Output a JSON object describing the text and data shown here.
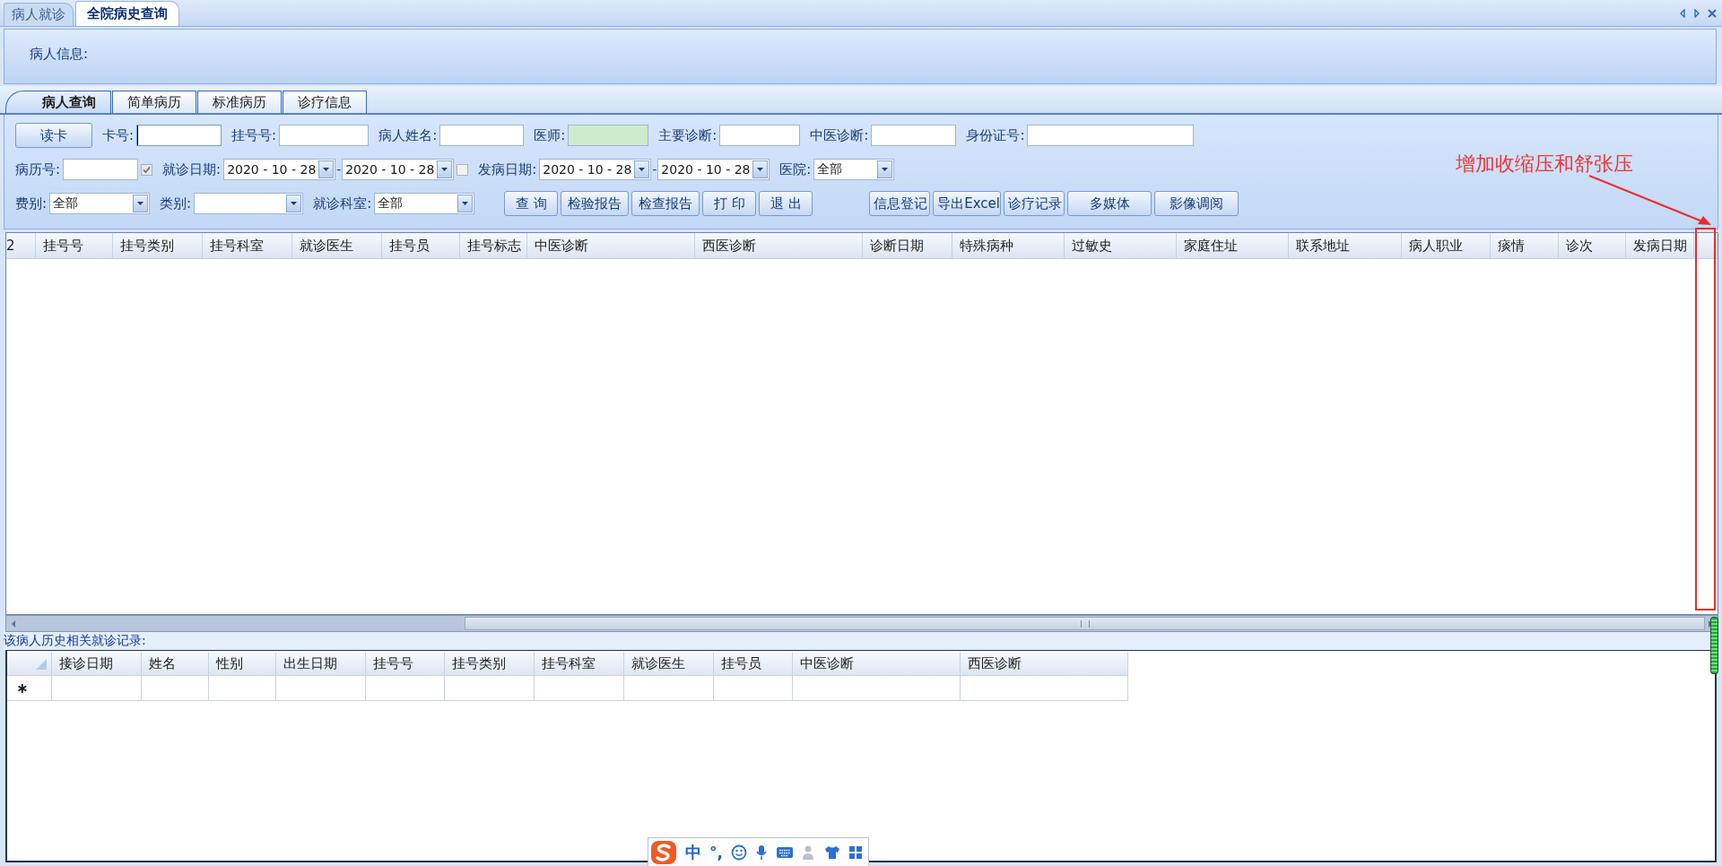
{
  "doc_tabs": [
    {
      "label": "病人就诊",
      "selected": false
    },
    {
      "label": "全院病史查询",
      "selected": true
    }
  ],
  "patient_info": {
    "label": "病人信息:"
  },
  "query_tabs": [
    {
      "label": "病人查询",
      "selected": true
    },
    {
      "label": "简单病历",
      "selected": false
    },
    {
      "label": "标准病历",
      "selected": false
    },
    {
      "label": "诊疗信息",
      "selected": false
    }
  ],
  "form": {
    "rows": [
      {
        "items": [
          {
            "kind": "button",
            "label": "读卡"
          },
          {
            "kind": "label",
            "text": "卡号:"
          },
          {
            "kind": "input",
            "focused": true
          },
          {
            "kind": "label",
            "text": "挂号号:"
          },
          {
            "kind": "input"
          },
          {
            "kind": "label",
            "text": "病人姓名:"
          },
          {
            "kind": "input"
          },
          {
            "kind": "label",
            "text": "医师:"
          },
          {
            "kind": "input",
            "readonly": true
          },
          {
            "kind": "label",
            "text": "主要诊断:"
          },
          {
            "kind": "input"
          },
          {
            "kind": "label",
            "text": "中医诊断:"
          },
          {
            "kind": "input"
          },
          {
            "kind": "label",
            "text": "身份证号:"
          },
          {
            "kind": "input"
          }
        ]
      },
      {
        "items": [
          {
            "kind": "label",
            "text": "病历号:"
          },
          {
            "kind": "input"
          },
          {
            "kind": "checkbox",
            "checked": true
          },
          {
            "kind": "label",
            "text": "就诊日期:"
          },
          {
            "kind": "date",
            "value": "2020 - 10 - 28"
          },
          {
            "kind": "dash",
            "text": "-"
          },
          {
            "kind": "date",
            "value": "2020 - 10 - 28"
          },
          {
            "kind": "checkbox",
            "checked": false
          },
          {
            "kind": "label",
            "text": "发病日期:"
          },
          {
            "kind": "date",
            "value": "2020 - 10 - 28"
          },
          {
            "kind": "dash",
            "text": "-"
          },
          {
            "kind": "date",
            "value": "2020 - 10 - 28"
          },
          {
            "kind": "label",
            "text": "医院:"
          },
          {
            "kind": "combo",
            "value": "全部"
          }
        ]
      },
      {
        "items": [
          {
            "kind": "label",
            "text": "费别:"
          },
          {
            "kind": "combo",
            "value": "全部"
          },
          {
            "kind": "label",
            "text": "类别:"
          },
          {
            "kind": "combo"
          },
          {
            "kind": "label",
            "text": "就诊科室:"
          },
          {
            "kind": "combo",
            "value": "全部"
          },
          {
            "kind": "button",
            "label": "查 询"
          },
          {
            "kind": "button",
            "label": "检验报告"
          },
          {
            "kind": "button",
            "label": "检查报告"
          },
          {
            "kind": "button",
            "label": "打 印"
          },
          {
            "kind": "button",
            "label": "退 出"
          },
          {
            "kind": "button",
            "label": "信息登记"
          },
          {
            "kind": "button",
            "label": "导出Excel"
          },
          {
            "kind": "button",
            "label": "诊疗记录"
          },
          {
            "kind": "button",
            "label": "多媒体"
          },
          {
            "kind": "button",
            "label": "影像调阅"
          }
        ]
      }
    ]
  },
  "results_grid": {
    "columns": [
      "2",
      "挂号号",
      "挂号类别",
      "挂号科室",
      "就诊医生",
      "挂号员",
      "挂号标志",
      "中医诊断",
      "西医诊断",
      "诊断日期",
      "特殊病种",
      "过敏史",
      "家庭住址",
      "联系地址",
      "病人职业",
      "痰情",
      "诊次",
      "发病日期"
    ]
  },
  "history": {
    "label": "该病人历史相关就诊记录:",
    "columns": [
      "接诊日期",
      "姓名",
      "性别",
      "出生日期",
      "挂号号",
      "挂号类别",
      "挂号科室",
      "就诊医生",
      "挂号员",
      "中医诊断",
      "西医诊断"
    ],
    "new_row_marker": "∗"
  },
  "annotation": {
    "text": "增加收缩压和舒张压"
  },
  "ime_bar": {
    "mode": "中",
    "punctuation": "°,"
  }
}
